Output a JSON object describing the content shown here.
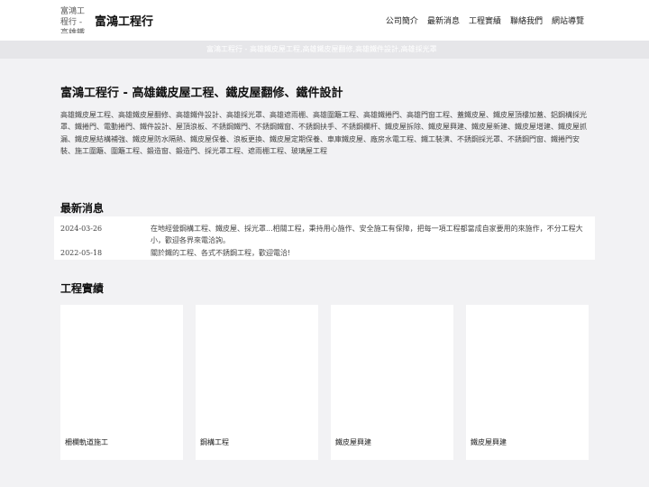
{
  "header": {
    "logo_alt": "富鴻工程行 - 高雄鐵皮屋工程",
    "brand": "富鴻工程行",
    "nav": [
      "公司簡介",
      "最新消息",
      "工程實績",
      "聯絡我們",
      "網站導覽"
    ]
  },
  "banner": {
    "alt": "富鴻工程行 - 高雄鐵皮屋工程,高雄鐵皮屋翻修,高雄鐵件設計,高雄採光罩"
  },
  "main": {
    "title": "富鴻工程行 - 高雄鐵皮屋工程、鐵皮屋翻修、鐵件設計",
    "keywords": "高雄鐵皮屋工程、高雄鐵皮屋翻修、高雄鐵件設計、高雄採光罩、高雄遮雨棚、高雄圍籬工程、高雄鐵捲門、高雄門窗工程、蓋鐵皮屋、鐵皮屋頂樓加蓋、鋁鋼構採光罩、鐵捲門、電動捲門、鐵件設計、屋頂浪板、不銹鋼鐵門、不銹鋼鐵窗、不銹鋼扶手、不銹鋼欄杆、鐵皮屋拆除、鐵皮屋興建、鐵皮屋新建、鐵皮屋增建、鐵皮屋抓漏、鐵皮屋結構補強、鐵皮屋防水隔熱、鐵皮屋保養、浪板更換、鐵皮屋定期保養、車庫鐵皮屋、廠房水電工程、鐵工裝潢、不銹鋼採光罩、不銹鋼門窗、鐵捲門安裝、施工圍籬、圍籬工程、鍛造窗、鍛造門、採光罩工程、遮雨棚工程、玻璃屋工程"
  },
  "news": {
    "title": "最新消息",
    "items": [
      {
        "date": "2024-03-26",
        "text": "在地經營鋼構工程、鐵皮屋、採光罩...相關工程，秉持用心施作、安全施工有保障，把每一項工程都當成自家要用的來施作，不分工程大小，歡迎各界來電洽詢。"
      },
      {
        "date": "2022-05-18",
        "text": "關於鐵的工程、各式不銹鋼工程，歡迎電洽!"
      }
    ]
  },
  "works": {
    "title": "工程實績",
    "items": [
      {
        "label": "柵欄軌道施工"
      },
      {
        "label": "鋼構工程"
      },
      {
        "label": "鐵皮屋興建"
      },
      {
        "label": "鐵皮屋興建"
      }
    ]
  }
}
